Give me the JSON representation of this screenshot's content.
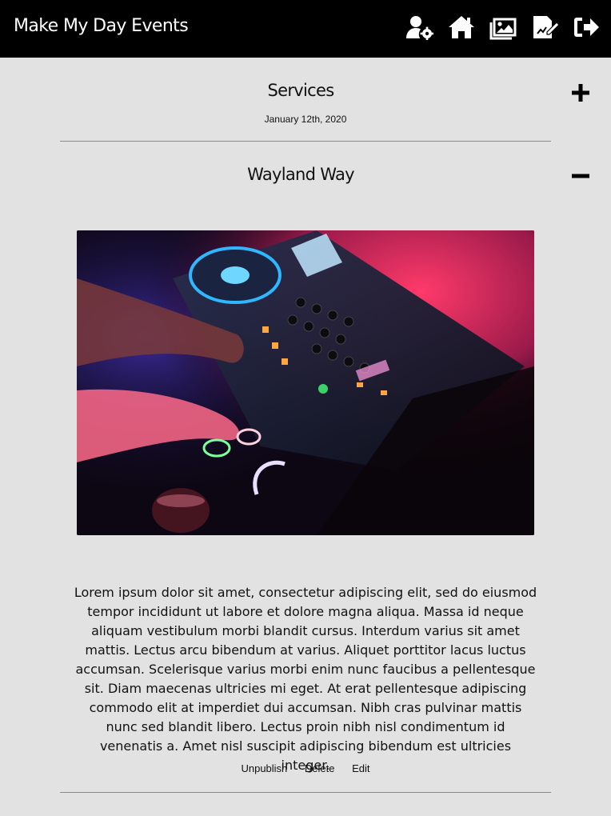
{
  "header": {
    "brand": "Make My Day Events",
    "nav": [
      {
        "icon": "user-settings-icon"
      },
      {
        "icon": "home-icon"
      },
      {
        "icon": "gallery-icon"
      },
      {
        "icon": "edit-document-icon"
      },
      {
        "icon": "logout-icon"
      }
    ]
  },
  "sections": [
    {
      "title": "Services",
      "date": "January 12th, 2020",
      "toggle": "plus-icon"
    },
    {
      "title": "Wayland Way",
      "toggle": "minus-icon",
      "image": "dj-mixer-photo",
      "body": "Lorem ipsum dolor sit amet, consectetur adipiscing elit, sed do eiusmod tempor incididunt ut labore et dolore magna aliqua. Massa id neque aliquam vestibulum morbi blandit cursus. Interdum varius sit amet mattis. Lectus arcu bibendum at varius. Aliquet porttitor lacus luctus accumsan. Scelerisque varius morbi enim nunc faucibus a pellentesque sit. Diam maecenas ultricies mi eget. At erat pellentesque adipiscing commodo elit at imperdiet dui accumsan. Nibh cras pulvinar mattis nunc sed blandit libero. Lectus proin nibh nisl condimentum id venenatis a. Amet nisl suscipit adipiscing bibendum est ultricies integer.",
      "actions": {
        "unpublish": "Unpublish",
        "delete": "Delete",
        "edit": "Edit"
      }
    }
  ],
  "colors": {
    "header_bg": "#000000",
    "page_bg": "#e2e2e2",
    "text": "#111111",
    "divider": "#8a8a8a"
  }
}
